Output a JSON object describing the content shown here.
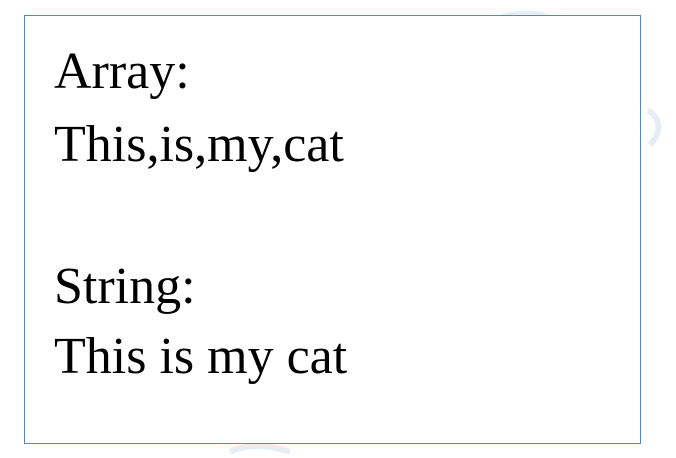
{
  "output": {
    "array_label": "Array:",
    "array_value": "This,is,my,cat",
    "string_label": "String:",
    "string_value": "This is my cat"
  },
  "colors": {
    "box_border": "#5b87b5",
    "text": "#000000",
    "background": "#ffffff",
    "watermark": "#e6edf4"
  }
}
